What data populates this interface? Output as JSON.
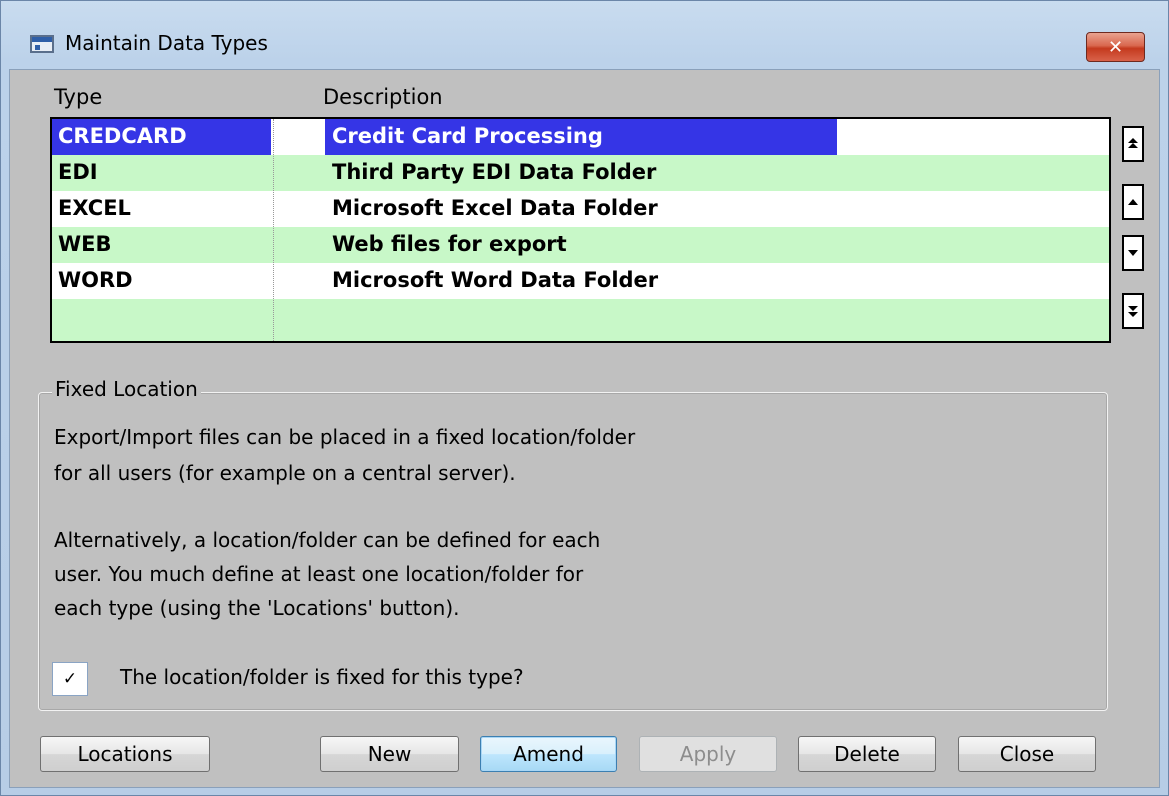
{
  "window": {
    "title": "Maintain Data Types",
    "close_label": "✕"
  },
  "grid": {
    "columns": [
      "Type",
      "Description"
    ],
    "rows": [
      {
        "type": "CREDCARD",
        "description": "Credit Card Processing",
        "selected": true
      },
      {
        "type": "EDI",
        "description": "Third Party EDI Data Folder"
      },
      {
        "type": "EXCEL",
        "description": "Microsoft Excel Data Folder"
      },
      {
        "type": "WEB",
        "description": "Web files for export"
      },
      {
        "type": "WORD",
        "description": "Microsoft Word Data Folder"
      },
      {
        "type": "",
        "description": ""
      }
    ],
    "colors": {
      "selected": "#3535e6",
      "green_row": "#c8f8c8",
      "white_row": "#ffffff"
    }
  },
  "scrollbar": {
    "first_icon": "double-up-arrow-icon",
    "up_icon": "up-arrow-icon",
    "down_icon": "down-arrow-icon",
    "last_icon": "double-down-arrow-icon"
  },
  "fixed_location": {
    "group_title": "Fixed Location",
    "line1": "Export/Import files can be placed in a fixed location/folder",
    "line2": "for all users (for example on a central server).",
    "line3": "Alternatively, a location/folder can be defined for each",
    "line4": "user.  You much define at least one location/folder for",
    "line5": "each type (using the 'Locations' button).",
    "checkbox_checked": true,
    "checkbox_mark": "✓",
    "checkbox_label": "The location/folder is fixed for this type?"
  },
  "buttons": {
    "locations": "Locations",
    "new": "New",
    "amend": "Amend",
    "apply": "Apply",
    "delete": "Delete",
    "close": "Close"
  }
}
